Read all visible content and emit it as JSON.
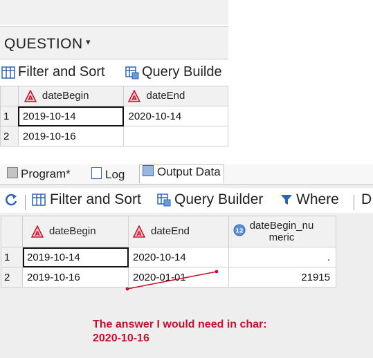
{
  "top": {
    "title": "QUESTION",
    "toolbar": {
      "filter_sort": "Filter and Sort",
      "query_builder": "Query Builde"
    },
    "table": {
      "columns": [
        "dateBegin",
        "dateEnd"
      ],
      "rows": [
        {
          "num": "1",
          "dateBegin": "2019-10-14",
          "dateEnd": "2020-10-14"
        },
        {
          "num": "2",
          "dateBegin": "2019-10-16",
          "dateEnd": ""
        }
      ]
    }
  },
  "bottom": {
    "tabs": [
      "Program*",
      "Log",
      "Output Data"
    ],
    "toolbar": {
      "filter_sort": "Filter and Sort",
      "query_builder": "Query Builder",
      "where": "Where",
      "more": "D"
    },
    "table": {
      "columns": [
        "dateBegin",
        "dateEnd",
        "dateBegin_nu meric"
      ],
      "rows": [
        {
          "num": "1",
          "dateBegin": "2019-10-14",
          "dateEnd": "2020-10-14",
          "dateBegin_numeric": "."
        },
        {
          "num": "2",
          "dateBegin": "2019-10-16",
          "dateEnd": "2020-01-01",
          "dateBegin_numeric": "21915"
        }
      ]
    },
    "annotation": {
      "line1": "The answer I would need in char:",
      "line2": "2020-10-16"
    }
  },
  "colors": {
    "annotation": "#c8102e",
    "header_bg": "#f1f1f1",
    "grid_line": "#cfcfcf"
  }
}
